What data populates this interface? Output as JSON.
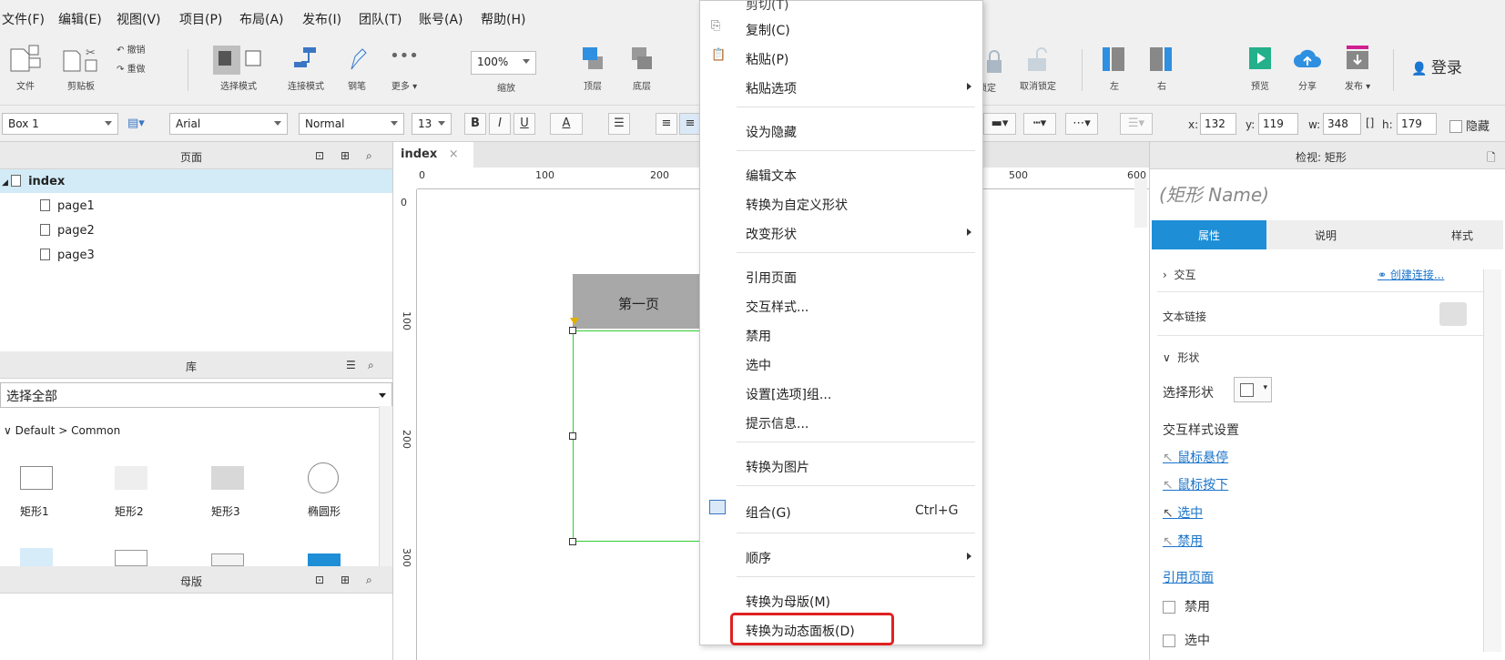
{
  "menubar": [
    "文件(F)",
    "编辑(E)",
    "视图(V)",
    "项目(P)",
    "布局(A)",
    "发布(I)",
    "团队(T)",
    "账号(A)",
    "帮助(H)"
  ],
  "toolbar": {
    "file": "文件",
    "clipboard": "剪贴板",
    "undo": "撤销",
    "redo": "重做",
    "select_mode": "选择模式",
    "connect_mode": "连接模式",
    "pen": "钢笔",
    "more": "更多 ▾",
    "zoom_value": "100%",
    "zoom": "缩放",
    "top_layer": "顶层",
    "bottom_layer": "底层",
    "lock": "锁定",
    "unlock": "取消锁定",
    "left": "左",
    "right": "右",
    "preview": "预览",
    "share": "分享",
    "publish": "发布 ▾",
    "login": "登录"
  },
  "format": {
    "widget_name": "Box 1",
    "font": "Arial",
    "style": "Normal",
    "size": "13",
    "bold": "B",
    "italic": "I",
    "underline": "U",
    "text_color": "A",
    "x_label": "x:",
    "x": "132",
    "y_label": "y:",
    "y": "119",
    "w_label": "w:",
    "w": "348",
    "h_label": "h:",
    "h": "179",
    "hidden": "隐藏"
  },
  "pages_panel": {
    "title": "页面",
    "items": [
      "index",
      "page1",
      "page2",
      "page3"
    ]
  },
  "library_panel": {
    "title": "库",
    "select_value": "选择全部",
    "group": "Default > Common",
    "widgets": [
      "矩形1",
      "矩形2",
      "矩形3",
      "椭圆形"
    ]
  },
  "masters_panel": {
    "title": "母版"
  },
  "canvas": {
    "tab": "index",
    "ruler_top": [
      "0",
      "100",
      "200",
      "500",
      "600"
    ],
    "ruler_left": [
      "0",
      "100",
      "200",
      "300"
    ],
    "widget_label": "第一页"
  },
  "inspector": {
    "title": "检视: 矩形",
    "name_placeholder": "(矩形 Name)",
    "tabs": [
      "属性",
      "说明",
      "样式"
    ],
    "interaction": "交互",
    "create_link": "创建连接...",
    "text_link": "文本链接",
    "shape_section": "形状",
    "select_shape": "选择形状",
    "interaction_styles": "交互样式设置",
    "styles": [
      "鼠标悬停",
      "鼠标按下",
      "选中",
      "禁用"
    ],
    "ref_page": "引用页面",
    "disabled": "禁用",
    "selected": "选中"
  },
  "context_menu": {
    "cut": "剪切(T)",
    "copy": "复制(C)",
    "paste": "粘贴(P)",
    "paste_options": "粘贴选项",
    "set_hidden": "设为隐藏",
    "edit_text": "编辑文本",
    "convert_custom": "转换为自定义形状",
    "change_shape": "改变形状",
    "ref_page": "引用页面",
    "interaction_styles": "交互样式...",
    "disable": "禁用",
    "select": "选中",
    "set_group": "设置[选项]组...",
    "tooltip": "提示信息...",
    "convert_image": "转换为图片",
    "group": "组合(G)",
    "group_shortcut": "Ctrl+G",
    "order": "顺序",
    "convert_master": "转换为母版(M)",
    "convert_dynamic": "转换为动态面板(D)"
  },
  "colors": {
    "accent": "#1e8fd6",
    "highlight_border": "#e02020",
    "selection": "#33cc33"
  }
}
